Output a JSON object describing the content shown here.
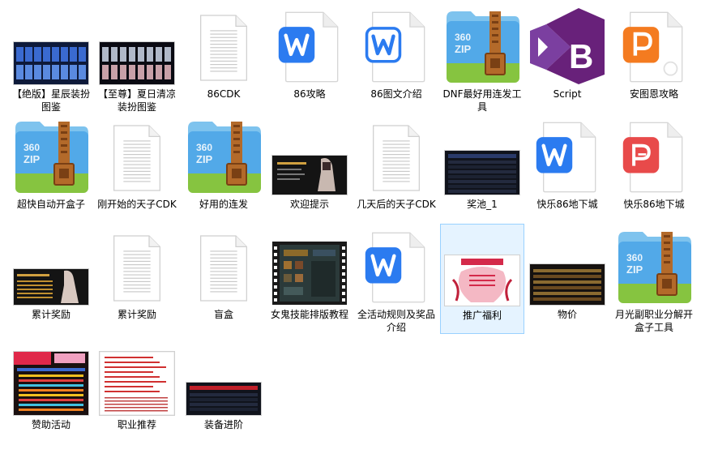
{
  "items": [
    {
      "label": "【绝版】星辰装扮图鉴",
      "type": "image",
      "theme": "gallery-blue"
    },
    {
      "label": "【至尊】夏日清凉装扮图鉴",
      "type": "image",
      "theme": "gallery-dark"
    },
    {
      "label": "86CDK",
      "type": "text-file",
      "icon": "text-file-icon"
    },
    {
      "label": "86攻略",
      "type": "word",
      "icon": "word-doc-icon"
    },
    {
      "label": "86图文介绍",
      "type": "word-outline",
      "icon": "word-doc-outline-icon"
    },
    {
      "label": "DNF最好用连发工具",
      "type": "zip",
      "icon": "zip-archive-icon",
      "brand": "360 ZIP"
    },
    {
      "label": "Script",
      "type": "vs",
      "icon": "visual-studio-icon"
    },
    {
      "label": "安图恩攻略",
      "type": "ppt",
      "icon": "presentation-doc-icon"
    },
    {
      "label": "超快自动开盒子",
      "type": "zip",
      "icon": "zip-archive-icon",
      "brand": "360 ZIP"
    },
    {
      "label": "刚开始的天子CDK",
      "type": "text-file",
      "icon": "text-file-icon"
    },
    {
      "label": "好用的连发",
      "type": "zip",
      "icon": "zip-archive-icon",
      "brand": "360 ZIP"
    },
    {
      "label": "欢迎提示",
      "type": "image",
      "theme": "dark-banner"
    },
    {
      "label": "几天后的天子CDK",
      "type": "text-file",
      "icon": "text-file-icon"
    },
    {
      "label": "奖池_1",
      "type": "image",
      "theme": "dark-table"
    },
    {
      "label": "快乐86地下城",
      "type": "word",
      "icon": "word-doc-icon"
    },
    {
      "label": "快乐86地下城",
      "type": "pdf",
      "icon": "pdf-doc-icon"
    },
    {
      "label": "累计奖励",
      "type": "image",
      "theme": "dark-banner-2"
    },
    {
      "label": "累计奖励",
      "type": "text-file",
      "icon": "text-file-icon"
    },
    {
      "label": "盲盒",
      "type": "text-file",
      "icon": "text-file-icon"
    },
    {
      "label": "女鬼技能排版教程",
      "type": "video",
      "icon": "video-file-icon"
    },
    {
      "label": "全活动规则及奖品介绍",
      "type": "word",
      "icon": "word-doc-icon"
    },
    {
      "label": "推广福利",
      "type": "image",
      "theme": "pink-poster",
      "selected": true
    },
    {
      "label": "物价",
      "type": "image",
      "theme": "dark-table-2"
    },
    {
      "label": "月光副职业分解开盒子工具",
      "type": "zip",
      "icon": "zip-archive-icon",
      "brand": "360 ZIP"
    },
    {
      "label": "赞助活动",
      "type": "image",
      "theme": "sponsor-poster"
    },
    {
      "label": "职业推荐",
      "type": "image",
      "theme": "white-doc"
    },
    {
      "label": "装备进阶",
      "type": "image",
      "theme": "dark-strip"
    }
  ]
}
